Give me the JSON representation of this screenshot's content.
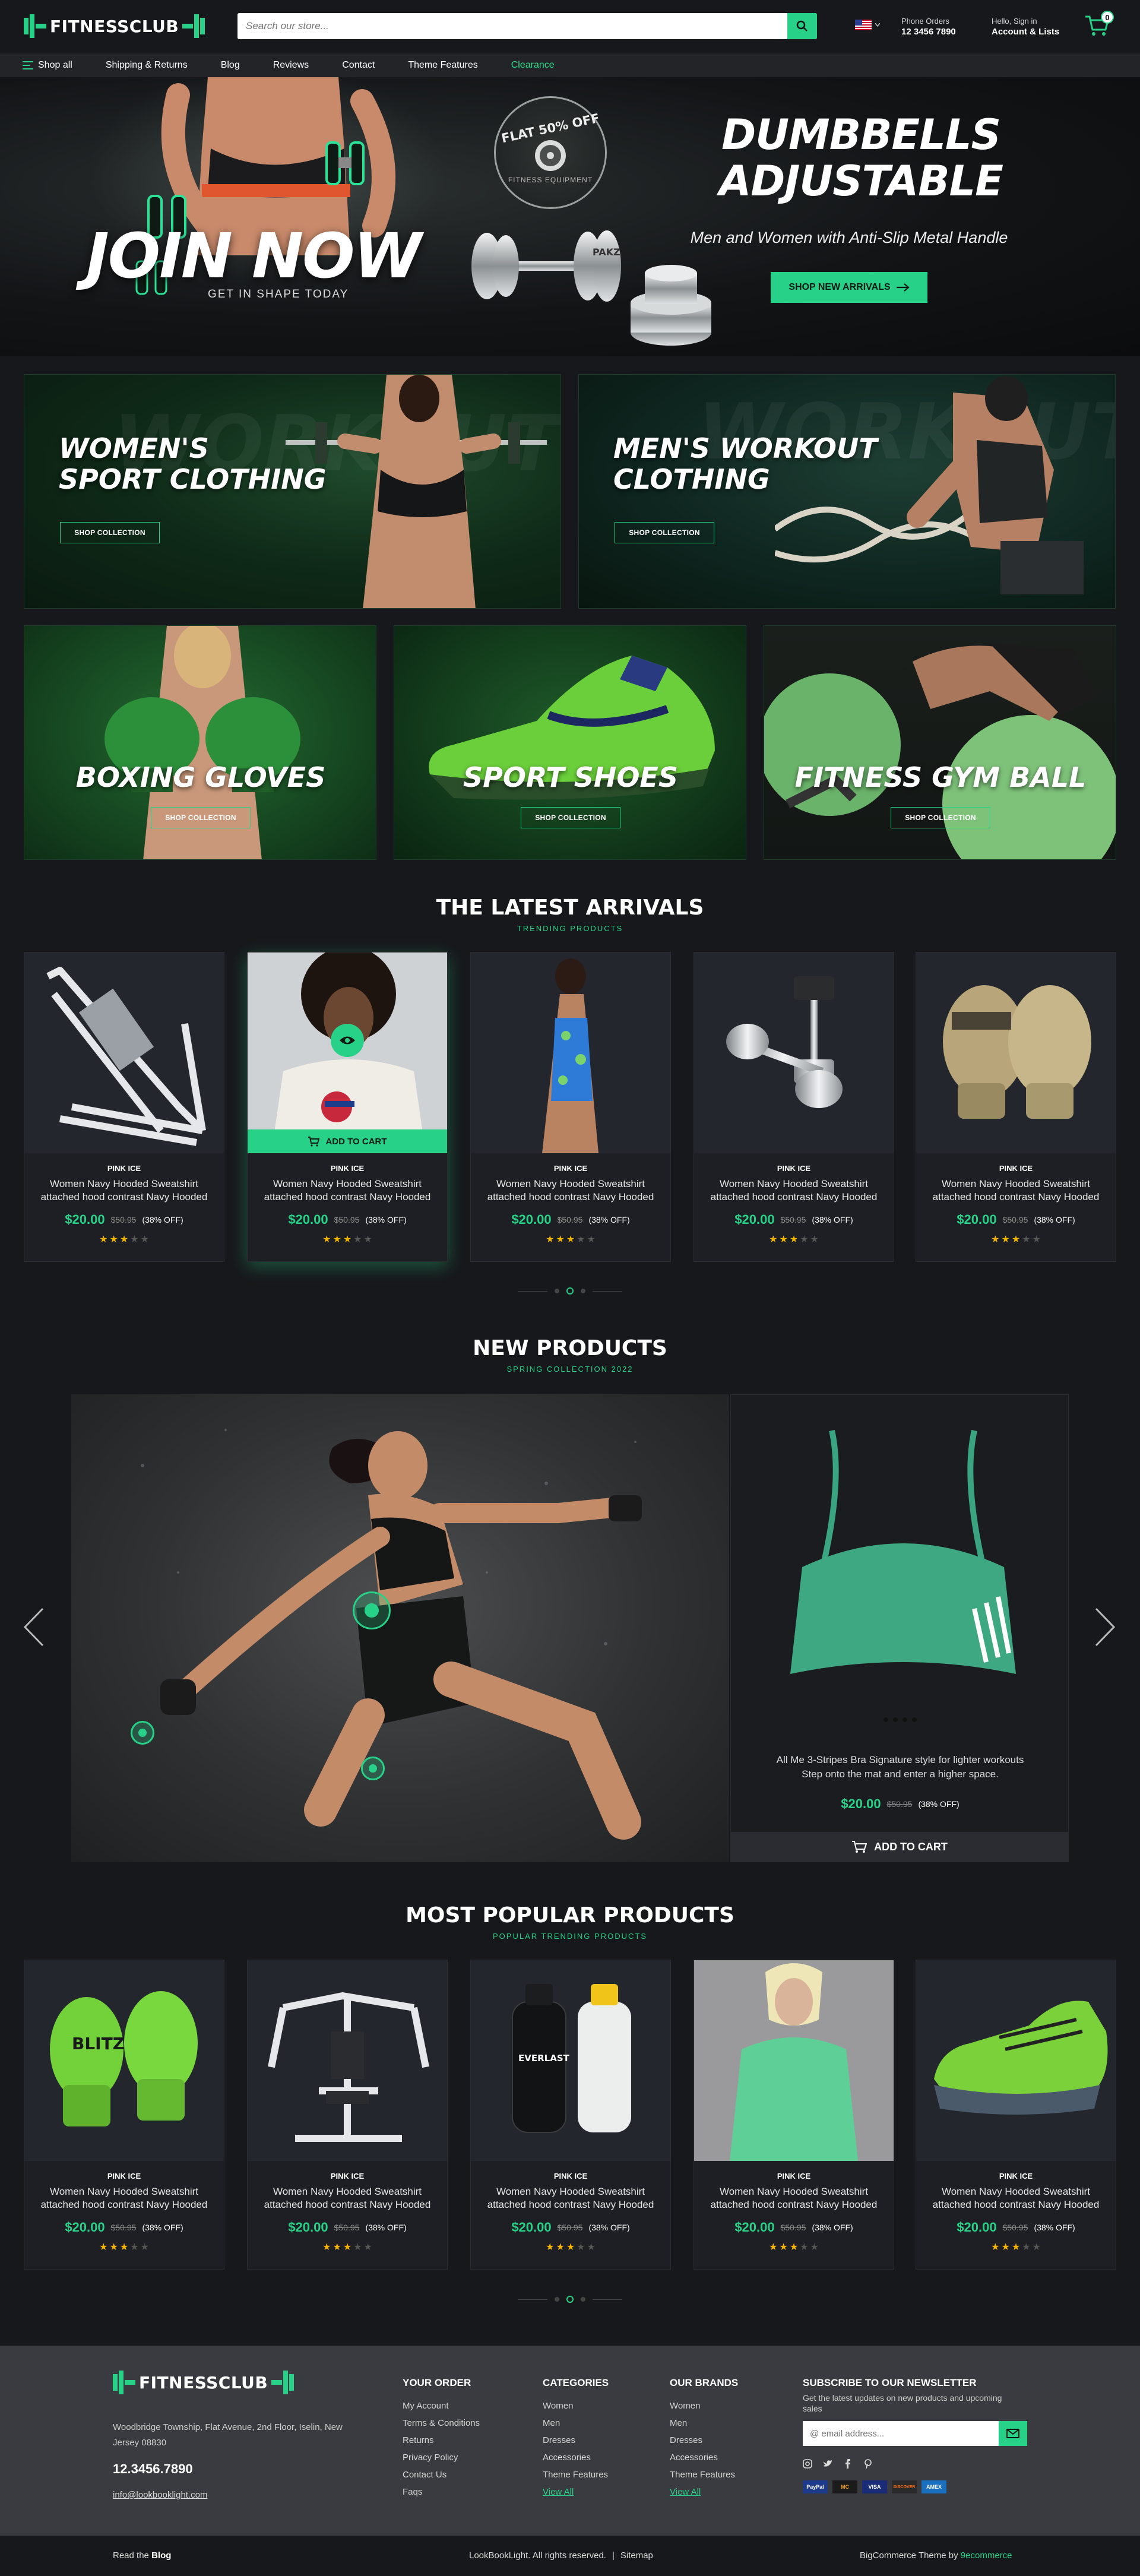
{
  "header": {
    "logo_text": "FITNESSCLUB",
    "search_placeholder": "Search our store...",
    "phone_label": "Phone Orders",
    "phone_number": "12 3456 7890",
    "account_greeting": "Hello, Sign in",
    "account_label": "Account & Lists",
    "cart_count": "0"
  },
  "nav": {
    "shop_all": "Shop all",
    "items": [
      "Shipping & Returns",
      "Blog",
      "Reviews",
      "Contact",
      "Theme Features"
    ],
    "clearance": "Clearance"
  },
  "hero": {
    "badge_line1": "FLAT 50% OFF",
    "badge_line2": "FITNESS EQUIPMENT",
    "join_now": "JOIN NOW",
    "get_in_shape": "GET IN SHAPE TODAY",
    "title_line1": "DUMBBELLS",
    "title_line2": "ADJUSTABLE",
    "subtitle": "Men and Women with Anti-Slip Metal Handle",
    "button": "SHOP NEW ARRIVALS",
    "dumbbell_text": "PAKZ"
  },
  "banners": [
    {
      "title_line1": "WOMEN'S",
      "title_line2": "SPORT CLOTHING",
      "button": "SHOP COLLECTION",
      "bg_word": "WORKOUT"
    },
    {
      "title_line1": "MEN'S WORKOUT",
      "title_line2": "CLOTHING",
      "button": "SHOP COLLECTION",
      "bg_word": "WORKOUT"
    },
    {
      "title_line1": "BOXING GLOVES",
      "button": "SHOP COLLECTION"
    },
    {
      "title_line1": "SPORT SHOES",
      "button": "SHOP COLLECTION"
    },
    {
      "title_line1": "FITNESS GYM BALL",
      "button": "SHOP COLLECTION"
    }
  ],
  "latest": {
    "title": "THE LATEST ARRIVALS",
    "subtitle": "TRENDING PRODUCTS",
    "add_to_cart": "ADD TO CART",
    "products": [
      {
        "brand": "PINK ICE",
        "name": "Women Navy Hooded Sweatshirt attached hood contrast Navy Hooded",
        "price": "$20.00",
        "old_price": "$50.95",
        "off": "(38% OFF)",
        "rating": 3
      },
      {
        "brand": "PINK ICE",
        "name": "Women Navy Hooded Sweatshirt attached hood contrast Navy Hooded",
        "price": "$20.00",
        "old_price": "$50.95",
        "off": "(38% OFF)",
        "rating": 3
      },
      {
        "brand": "PINK ICE",
        "name": "Women Navy Hooded Sweatshirt attached hood contrast Navy Hooded",
        "price": "$20.00",
        "old_price": "$50.95",
        "off": "(38% OFF)",
        "rating": 3
      },
      {
        "brand": "PINK ICE",
        "name": "Women Navy Hooded Sweatshirt attached hood contrast Navy Hooded",
        "price": "$20.00",
        "old_price": "$50.95",
        "off": "(38% OFF)",
        "rating": 3
      },
      {
        "brand": "PINK ICE",
        "name": "Women Navy Hooded Sweatshirt attached hood contrast Navy Hooded",
        "price": "$20.00",
        "old_price": "$50.95",
        "off": "(38% OFF)",
        "rating": 3
      }
    ]
  },
  "new_products": {
    "title": "NEW PRODUCTS",
    "subtitle": "SPRING COLLECTION 2022",
    "desc_line1": "All Me 3-Stripes Bra Signature style for lighter workouts",
    "desc_line2": "Step onto the mat and enter a higher space.",
    "price": "$20.00",
    "old_price": "$50.95",
    "off": "(38% OFF)",
    "add_to_cart": "ADD TO CART"
  },
  "popular": {
    "title": "MOST POPULAR PRODUCTS",
    "subtitle": "POPULAR TRENDING PRODUCTS",
    "products": [
      {
        "brand": "PINK ICE",
        "name": "Women Navy Hooded Sweatshirt attached hood contrast Navy Hooded",
        "price": "$20.00",
        "old_price": "$50.95",
        "off": "(38% OFF)",
        "rating": 3,
        "img_text": "BLITZ"
      },
      {
        "brand": "PINK ICE",
        "name": "Women Navy Hooded Sweatshirt attached hood contrast Navy Hooded",
        "price": "$20.00",
        "old_price": "$50.95",
        "off": "(38% OFF)",
        "rating": 3
      },
      {
        "brand": "PINK ICE",
        "name": "Women Navy Hooded Sweatshirt attached hood contrast Navy Hooded",
        "price": "$20.00",
        "old_price": "$50.95",
        "off": "(38% OFF)",
        "rating": 3,
        "img_text": "EVERLAST"
      },
      {
        "brand": "PINK ICE",
        "name": "Women Navy Hooded Sweatshirt attached hood contrast Navy Hooded",
        "price": "$20.00",
        "old_price": "$50.95",
        "off": "(38% OFF)",
        "rating": 3
      },
      {
        "brand": "PINK ICE",
        "name": "Women Navy Hooded Sweatshirt attached hood contrast Navy Hooded",
        "price": "$20.00",
        "old_price": "$50.95",
        "off": "(38% OFF)",
        "rating": 3
      }
    ]
  },
  "footer": {
    "logo_text": "FITNESSCLUB",
    "address": "Woodbridge Township, Flat Avenue, 2nd Floor, Iselin, New Jersey 08830",
    "phone": "12.3456.7890",
    "email": "info@lookbooklight.com",
    "your_order": {
      "title": "YOUR ORDER",
      "links": [
        "My Account",
        "Terms & Conditions",
        "Returns",
        "Privacy Policy",
        "Contact Us",
        "Faqs"
      ]
    },
    "categories": {
      "title": "CATEGORIES",
      "links": [
        "Women",
        "Men",
        "Dresses",
        "Accessories",
        "Theme Features"
      ],
      "view_all": "View All"
    },
    "brands": {
      "title": "OUR BRANDS",
      "links": [
        "Women",
        "Men",
        "Dresses",
        "Accessories",
        "Theme Features"
      ],
      "view_all": "View All"
    },
    "newsletter": {
      "title": "SUBSCRIBE TO OUR NEWSLETTER",
      "text": "Get the latest updates on new products and upcoming sales",
      "placeholder": "@ email address..."
    },
    "payments": [
      "PayPal",
      "MC",
      "VISA",
      "DISCOVER",
      "AMEX"
    ]
  },
  "bottom": {
    "read_the": "Read the",
    "blog": "Blog",
    "copyright": "LookBookLight. All rights reserved.",
    "sep": "|",
    "sitemap": "Sitemap",
    "theme_by": "BigCommerce Theme by",
    "theme_author": "9ecommerce"
  },
  "colors": {
    "accent": "#27d188",
    "bg": "#17181b",
    "card": "#1d1f24",
    "footer": "#3a3b40"
  }
}
